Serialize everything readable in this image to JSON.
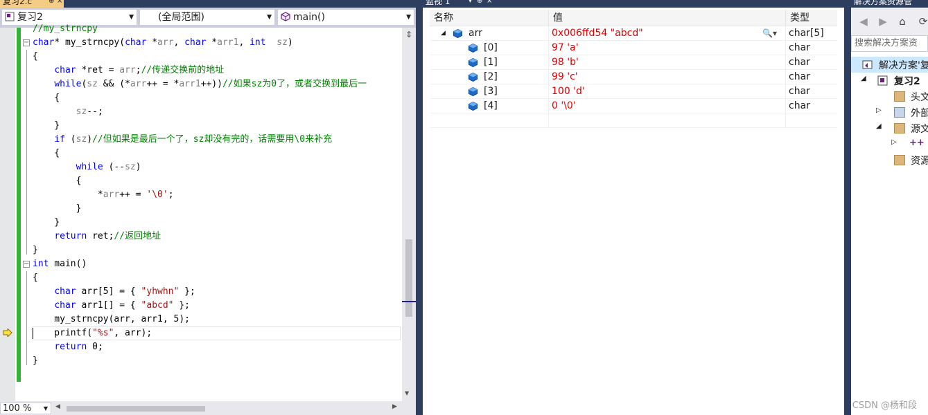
{
  "editor": {
    "tab_label": "复习2.c",
    "tab_pin": "⊕",
    "tab_close": "×",
    "nav": {
      "project": "复习2",
      "scope": "(全局范围)",
      "function": "main()"
    },
    "code_lines": [
      "//my_strncpy",
      "char* my_strncpy(char *arr, char *arr1, int  sz)",
      "{",
      "    char *ret = arr;//传递交换前的地址",
      "    while(sz && (*arr++ = *arr1++))//如果sz为0了，或者交换到最后一",
      "    {",
      "        sz--;",
      "    }",
      "    if (sz)//但如果是最后一个了，sz却没有完的，话需要用\\0来补充",
      "    {",
      "        while (--sz)",
      "        {",
      "            *arr++ = '\\0';",
      "        }",
      "    }",
      "    return ret;//返回地址",
      "}",
      "int main()",
      "{",
      "    char arr[5] = { \"yhwhn\" };",
      "    char arr1[] = { \"abcd\" };",
      "    my_strncpy(arr, arr1, 5);",
      "    printf(\"%s\", arr);",
      "    return 0;",
      "}"
    ],
    "zoom": "100 %"
  },
  "watch": {
    "tab_label": "监视 1",
    "columns": {
      "name": "名称",
      "value": "值",
      "type": "类型"
    },
    "rows": [
      {
        "name": "arr",
        "value": "0x006ffd54 \"abcd\"",
        "type": "char[5]",
        "expanded": true,
        "level": 0
      },
      {
        "name": "[0]",
        "value": "97 'a'",
        "type": "char",
        "level": 1
      },
      {
        "name": "[1]",
        "value": "98 'b'",
        "type": "char",
        "level": 1
      },
      {
        "name": "[2]",
        "value": "99 'c'",
        "type": "char",
        "level": 1
      },
      {
        "name": "[3]",
        "value": "100 'd'",
        "type": "char",
        "level": 1
      },
      {
        "name": "[4]",
        "value": "0 '\\0'",
        "type": "char",
        "level": 1
      }
    ]
  },
  "solution": {
    "title": "解决方案资源管",
    "search_placeholder": "搜索解决方案资",
    "tree": [
      {
        "label": "解决方案'复",
        "level": 0,
        "icon": "solution-icon",
        "selected": true
      },
      {
        "label": "复习2",
        "level": 1,
        "icon": "project-icon",
        "expander": "◢",
        "bold": true
      },
      {
        "label": "头文",
        "level": 2,
        "icon": "folder-icon"
      },
      {
        "label": "外部",
        "level": 2,
        "icon": "external-folder-icon",
        "expander": "▷"
      },
      {
        "label": "源文",
        "level": 2,
        "icon": "folder-icon",
        "expander": "◢"
      },
      {
        "label": "",
        "level": 3,
        "icon": "cpp-file-icon",
        "expander": "▷"
      },
      {
        "label": "资源",
        "level": 2,
        "icon": "folder-icon"
      }
    ]
  },
  "watermark": "CSDN @杨和段",
  "colors": {
    "frame": "#2d3e5f",
    "active_tab": "#f5cc84",
    "change_bar": "#34b233",
    "watch_value": "#e00000",
    "keyword": "#0000ff",
    "comment": "#008000",
    "string": "#a31515"
  }
}
